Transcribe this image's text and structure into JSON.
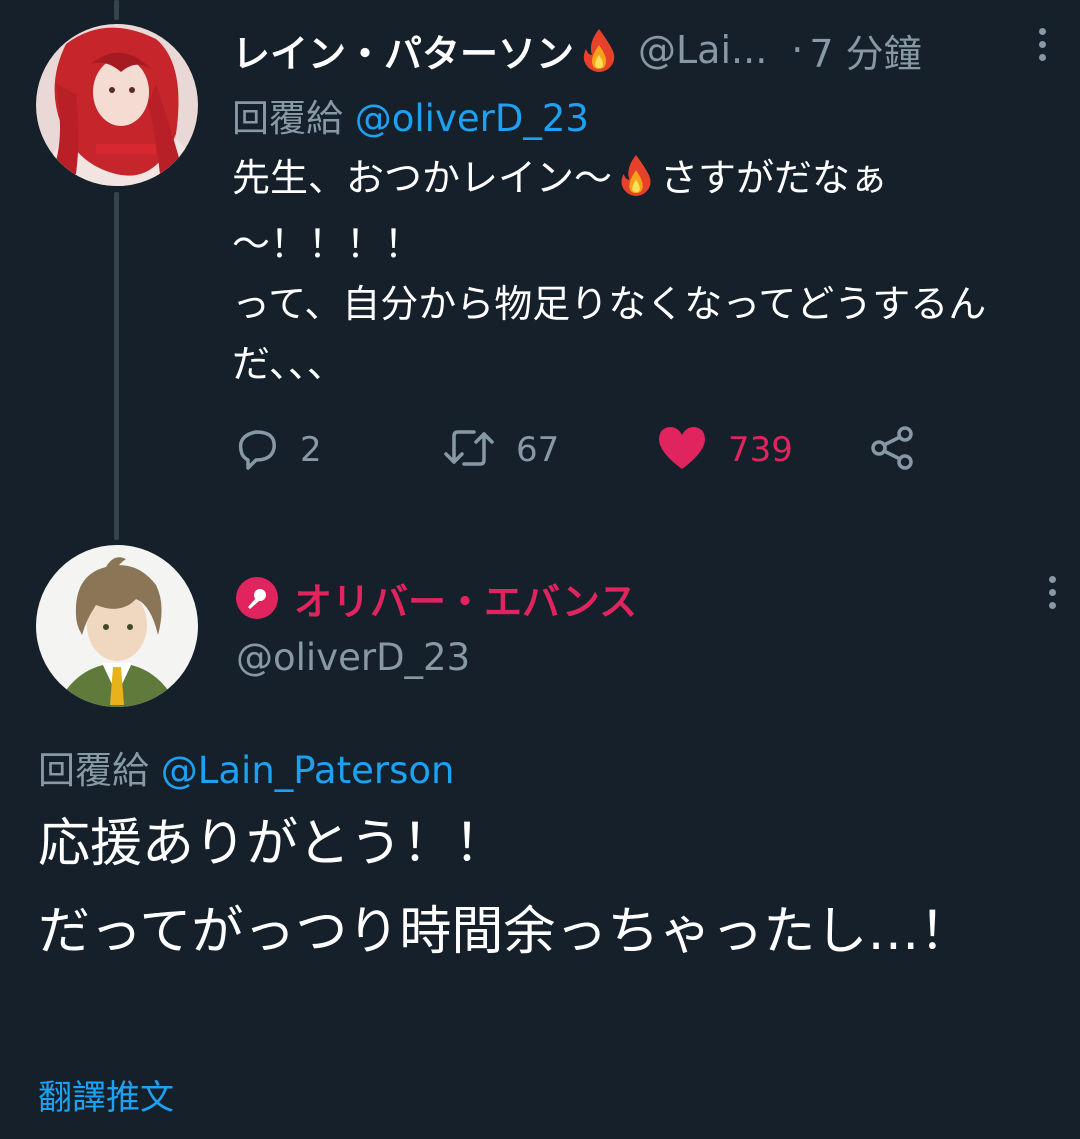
{
  "tweet1": {
    "display_name": "レイン・パターソン",
    "handle": "@Lai...",
    "dot": "·",
    "time": "7 分鐘",
    "reply_prefix": "回覆給",
    "reply_mention": "@oliverD_23",
    "text_part1": "先生、おつかレイン〜",
    "text_part2": "さすがだなぁ\n〜！！！！\nって、自分から物足りなくなってどうするんだ、、、",
    "reply_count": "2",
    "retweet_count": "67",
    "like_count": "739",
    "icons": [
      "fire-emoji-icon",
      "reply-icon",
      "retweet-icon",
      "heart-icon",
      "share-icon",
      "more-icon"
    ]
  },
  "tweet2": {
    "display_name": "オリバー・エバンス",
    "handle": "@oliverD_23",
    "reply_prefix": "回覆給",
    "reply_mention": "@Lain_Paterson",
    "text": "応援ありがとう！！\nだってがっつり時間余っちゃったし…！",
    "translate_label": "翻譯推文",
    "icons": [
      "microphone-badge-icon",
      "more-icon"
    ]
  },
  "colors": {
    "background": "#15202b",
    "secondary_text": "#8899a6",
    "link": "#1da1f2",
    "like": "#e0245e",
    "thread_line": "#38444d"
  }
}
